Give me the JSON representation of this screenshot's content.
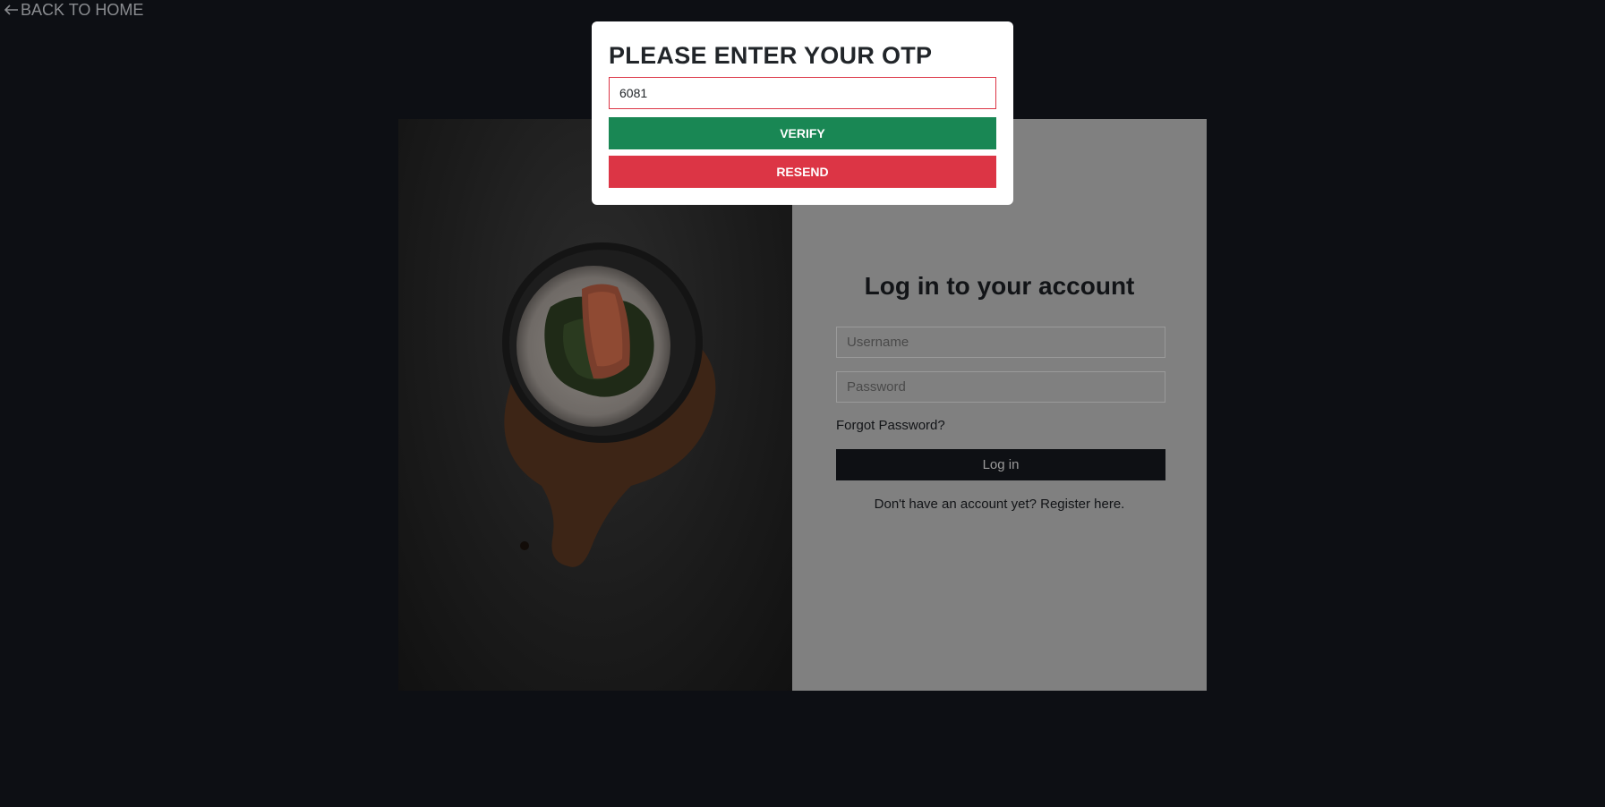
{
  "nav": {
    "back_label": "BACK TO HOME",
    "back_icon": "arrow-left-icon"
  },
  "login": {
    "title": "Log in to your account",
    "username_placeholder": "Username",
    "password_placeholder": "Password",
    "forgot_label": "Forgot Password?",
    "login_button": "Log in",
    "register_text": "Don't have an account yet? Register here."
  },
  "otp_modal": {
    "title": "PLEASE ENTER YOUR OTP",
    "otp_value": "6081",
    "verify_label": "VERIFY",
    "resend_label": "RESEND"
  },
  "colors": {
    "page_background": "#0d0f14",
    "verify": "#198754",
    "resend": "#dc3545",
    "form_panel": "#808080",
    "login_button": "#0e1014"
  }
}
